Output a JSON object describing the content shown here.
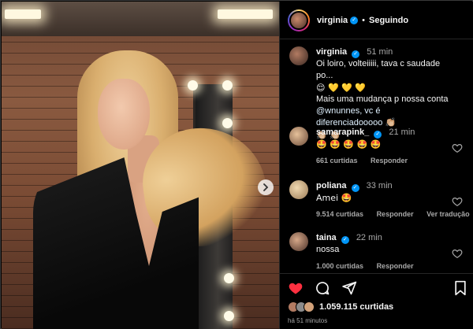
{
  "post": {
    "author": "virginia",
    "follow_status": "Seguindo",
    "separator": "•"
  },
  "comments": [
    {
      "user": "virginia",
      "time": "51 min",
      "verified": true,
      "lines": [
        "Oi loiro, volteiiiii, tava c saudade po...",
        "😌 💛 💛 💛",
        "Mais uma mudança p nossa conta",
        "@wnunnes, vc é diferenciadooooo 👏🏼",
        "👏🏼 👏🏼"
      ]
    },
    {
      "user": "samarapink_",
      "time": "21 min",
      "verified": true,
      "text": "🤩 🤩 🤩 🤩 🤩",
      "likes": "661 curtidas",
      "reply": "Responder"
    },
    {
      "user": "poliana",
      "time": "33 min",
      "verified": true,
      "text": "Amei 🤩",
      "likes": "9.514 curtidas",
      "reply": "Responder",
      "translate": "Ver tradução"
    },
    {
      "user": "taina",
      "time": "22 min",
      "verified": true,
      "text": "nossa",
      "likes": "1.000 curtidas",
      "reply": "Responder"
    }
  ],
  "actions": {
    "likes": "1.059.115 curtidas",
    "time_ago": "há 51 minutos"
  },
  "icons": {
    "next": "chevron-right-icon",
    "like": "heart-filled-icon",
    "comment": "speech-bubble-icon",
    "share": "paper-plane-icon",
    "save": "bookmark-icon"
  },
  "colors": {
    "like": "#ff3040",
    "verified": "#0095f6",
    "muted": "#a8a8a8",
    "background": "#000000"
  }
}
